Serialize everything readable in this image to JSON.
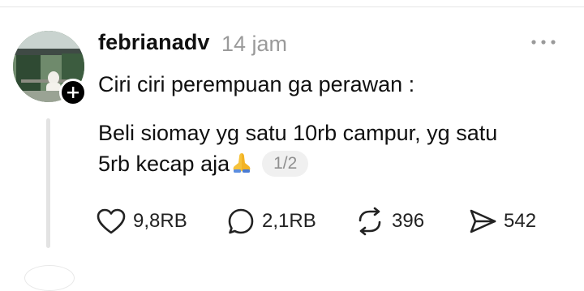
{
  "post": {
    "username": "febrianadv",
    "timestamp": "14 jam",
    "text_line1": "Ciri ciri perempuan ga perawan :",
    "text_line2a": "Beli siomay yg satu 10rb campur, yg satu",
    "text_line2b": "5rb kecap aja",
    "emoji": "folded-hands",
    "page_indicator": "1/2"
  },
  "actions": {
    "likes": "9,8RB",
    "comments": "2,1RB",
    "reposts": "396",
    "shares": "542"
  },
  "icons": {
    "more": "more-horizontal-icon",
    "follow": "plus-icon",
    "like": "heart-icon",
    "comment": "comment-icon",
    "repost": "repost-icon",
    "share": "send-icon"
  },
  "colors": {
    "text": "#101010",
    "muted": "#9a9a9a",
    "thread_line": "#e3e3e3",
    "badge": "#000000"
  }
}
